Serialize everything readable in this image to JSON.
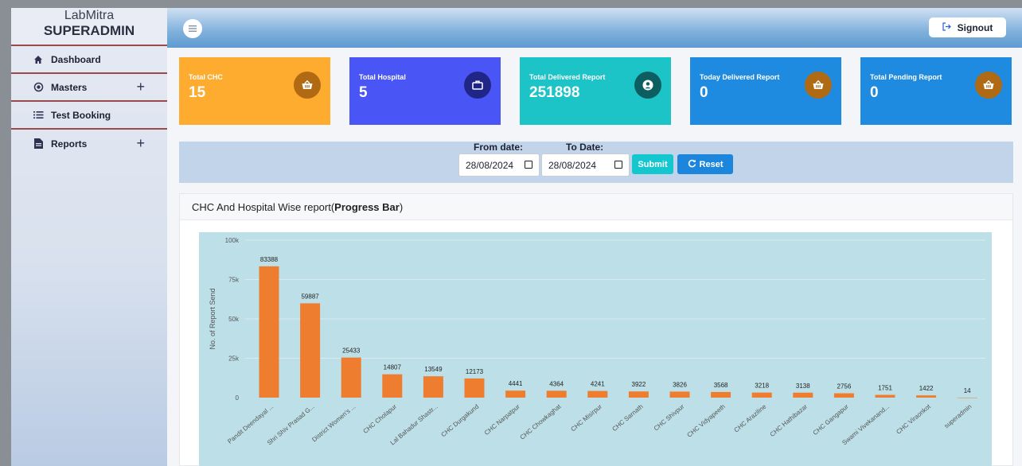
{
  "sidebar": {
    "brand_line1": "LabMitra",
    "brand_line2": "SUPERADMIN",
    "items": [
      {
        "label": "Dashboard",
        "has_plus": false,
        "icon": "home-icon"
      },
      {
        "label": "Masters",
        "has_plus": true,
        "icon": "target-icon"
      },
      {
        "label": "Test Booking",
        "has_plus": false,
        "icon": "list-icon"
      },
      {
        "label": "Reports",
        "has_plus": true,
        "icon": "document-icon"
      }
    ],
    "plus": "+"
  },
  "header": {
    "signout_label": "Signout"
  },
  "cards": [
    {
      "title": "Total CHC",
      "value": "15",
      "bg": "#fdac30",
      "icon_bg": "#b06a13",
      "icon": "basket-icon"
    },
    {
      "title": "Total Hospital",
      "value": "5",
      "bg": "#4a55f5",
      "icon_bg": "#1f2687",
      "icon": "briefcase-icon"
    },
    {
      "title": "Total Delivered Report",
      "value": "251898",
      "bg": "#1cc4c7",
      "icon_bg": "#0d5e60",
      "icon": "user-circle-icon"
    },
    {
      "title": "Today Delivered Report",
      "value": "0",
      "bg": "#1f8be0",
      "icon_bg": "#b06a13",
      "icon": "basket-icon"
    },
    {
      "title": "Total Pending Report",
      "value": "0",
      "bg": "#1f8be0",
      "icon_bg": "#b06a13",
      "icon": "basket-icon"
    }
  ],
  "filter": {
    "from_label": "From date:",
    "to_label": "To Date:",
    "from_value": "28/08/2024",
    "to_value": "28/08/2024",
    "submit_label": "Submit",
    "reset_label": "Reset"
  },
  "panel": {
    "title_prefix": "CHC And Hospital Wise report(",
    "title_bold": "Progress Bar",
    "title_suffix": ")"
  },
  "chart_data": {
    "type": "bar",
    "categories": [
      "Pandit Deendayal ...",
      "Shri Shiv Prasad G...",
      "District Women's ...",
      "CHC Cholapur",
      "Lal Bahadur Shastr...",
      "CHC Durgakund",
      "CHC Narpatpur",
      "CHC Chowkaghat",
      "CHC Misirpur",
      "CHC Sarnath",
      "CHC Shivpur",
      "CHC Vidyapeeth",
      "CHC Araziline",
      "CHC Hathibazar",
      "CHC Gangapur",
      "Swami Vivekanand...",
      "CHC Viraonkot",
      "superadmin"
    ],
    "values": [
      83388,
      59887,
      25433,
      14807,
      13549,
      12173,
      4441,
      4364,
      4241,
      3922,
      3826,
      3568,
      3218,
      3138,
      2756,
      1751,
      1422,
      14
    ],
    "ylabel": "No. of Report Send",
    "ylim": [
      0,
      100000
    ],
    "yticks": [
      "0",
      "25k",
      "50k",
      "75k",
      "100k"
    ],
    "bar_color": "#ef7d2f",
    "background": "#bde0e8",
    "grid": true
  }
}
